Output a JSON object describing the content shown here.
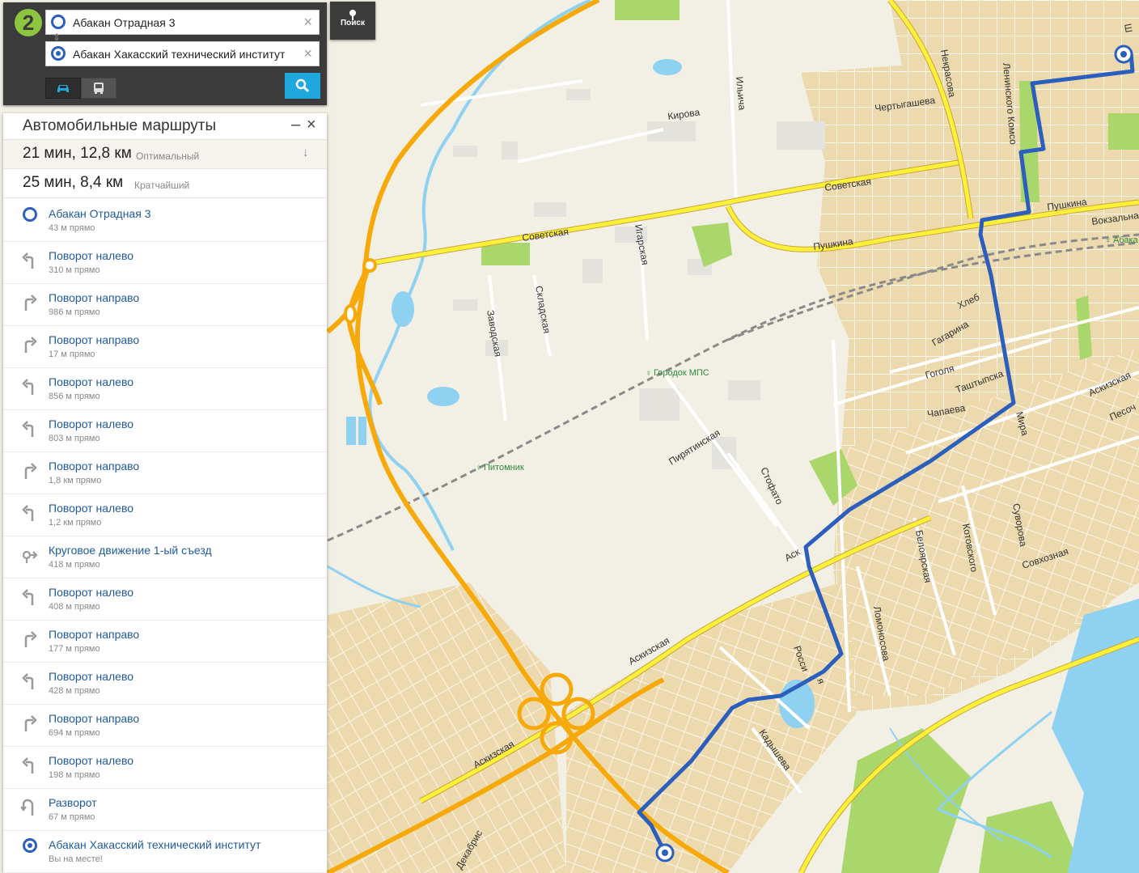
{
  "search": {
    "logo": "2",
    "from_value": "Абакан Отрадная 3",
    "to_value": "Абакан Хакасский технический институт",
    "clear_symbol": "×",
    "poisk_label": "Поиск"
  },
  "route_panel": {
    "title": "Автомобильные маршруты",
    "minimize": "–",
    "close": "×",
    "variants": [
      {
        "summary": "21 мин, 12,8 км",
        "type": "Оптимальный",
        "arrow": "↓"
      },
      {
        "summary": "25 мин, 8,4 км",
        "type": "Кратчайший"
      }
    ],
    "steps": [
      {
        "label": "Абакан Отрадная 3",
        "sub": "43 м прямо",
        "icon": "start-marker-icon"
      },
      {
        "label": "Поворот налево",
        "sub": "310 м прямо",
        "icon": "turn-left-icon"
      },
      {
        "label": "Поворот направо",
        "sub": "986 м прямо",
        "icon": "turn-right-icon"
      },
      {
        "label": "Поворот направо",
        "sub": "17 м прямо",
        "icon": "turn-right-icon"
      },
      {
        "label": "Поворот налево",
        "sub": "856 м прямо",
        "icon": "turn-left-icon"
      },
      {
        "label": "Поворот налево",
        "sub": "803 м прямо",
        "icon": "turn-left-icon"
      },
      {
        "label": "Поворот направо",
        "sub": "1,8 км прямо",
        "icon": "turn-right-icon"
      },
      {
        "label": "Поворот налево",
        "sub": "1,2 км прямо",
        "icon": "turn-left-icon"
      },
      {
        "label": "Круговое движение 1-ый съезд",
        "sub": "418 м прямо",
        "icon": "roundabout-icon"
      },
      {
        "label": "Поворот налево",
        "sub": "408 м прямо",
        "icon": "turn-left-icon"
      },
      {
        "label": "Поворот направо",
        "sub": "177 м прямо",
        "icon": "turn-right-icon"
      },
      {
        "label": "Поворот налево",
        "sub": "428 м прямо",
        "icon": "turn-left-icon"
      },
      {
        "label": "Поворот направо",
        "sub": "694 м прямо",
        "icon": "turn-right-icon"
      },
      {
        "label": "Поворот налево",
        "sub": "198 м прямо",
        "icon": "turn-left-icon"
      },
      {
        "label": "Разворот",
        "sub": "67 м прямо",
        "icon": "u-turn-icon"
      },
      {
        "label": "Абакан Хакасский технический институт",
        "sub": "Вы на месте!",
        "icon": "finish-marker-icon"
      }
    ]
  },
  "map": {
    "streets": {
      "nekrasova": "Некрасова",
      "ilyicha": "Ильича",
      "kirova": "Кирова",
      "chertygasheva": "Чертыгашева",
      "leninskogo": "Ленинского Комсо",
      "sovetskaya1": "Советская",
      "sovetskaya2": "Советская",
      "pushkina1": "Пушкина",
      "pushkina2": "Пушкина",
      "vokzalna": "Вокзальна",
      "igarskaya": "Игарская",
      "skladskaya": "Складская",
      "zavodskaya": "Заводская",
      "hleb": "Хлеб",
      "gagarina": "Гагарина",
      "gogolya": "Гоголя",
      "tashtypska": "Таштыпска",
      "chapaeva": "Чапаева",
      "mira": "Мира",
      "askizskaya_ne": "Аскизская",
      "pesoch": "Песоч",
      "piryatinskaya": "Пирятинская",
      "stofato": "Стофато",
      "belyarskaya": "Белоярская",
      "kotovskogo": "Котовского",
      "suvorova": "Суворова",
      "sovhoznaya": "Совхозная",
      "lomonosova": "Ломоносова",
      "askizskaya_mid": "Аскизская",
      "askizskaya_sw": "Аскизская",
      "ask": "Аск",
      "rossii": "Росси",
      "kadysheva": "Кадышева",
      "dekabristov": "Декабрис",
      "ya": "я",
      "sh": "Ш"
    },
    "pois": {
      "gorodok_mps": "Городок МПС",
      "pitomnik": "Питомник",
      "abaka": "Абака"
    },
    "colors": {
      "route": "#2c5ebd",
      "highway": "#f7a90a",
      "water": "#8fd1f1",
      "urban": "#eedcb4",
      "park": "#a9d76b",
      "land": "#f2efe4"
    }
  }
}
